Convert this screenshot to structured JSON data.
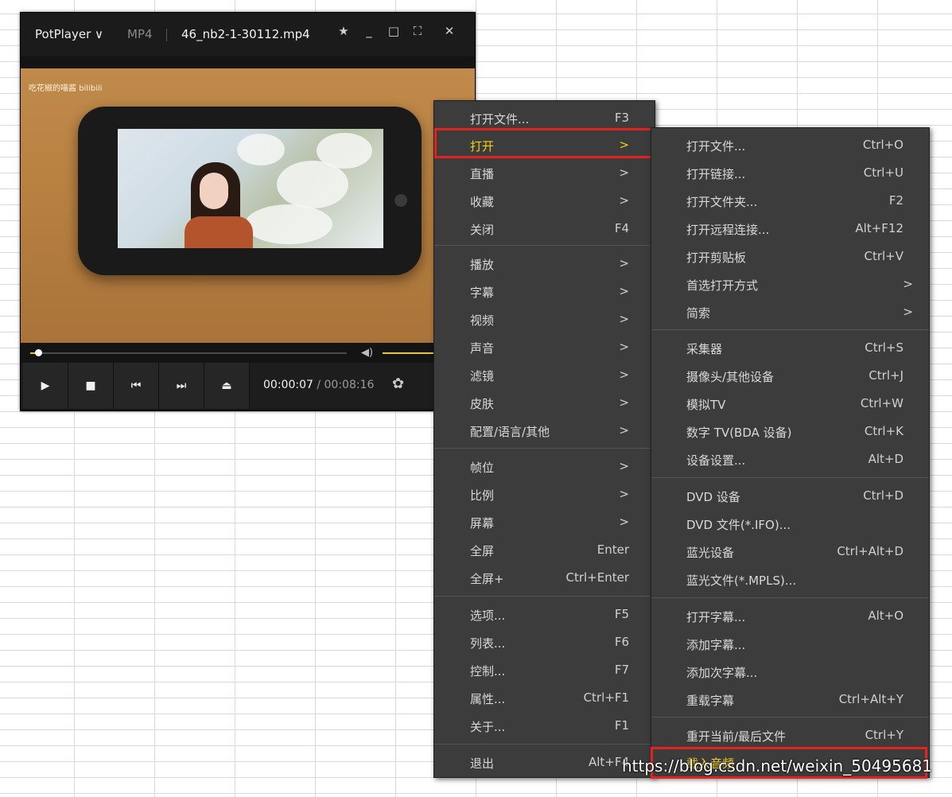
{
  "player": {
    "app_name": "PotPlayer ∨",
    "format": "MP4",
    "filename": "46_nb2-1-30112.mp4",
    "title_buttons": [
      "pin-icon",
      "minimize-icon",
      "maximize-icon",
      "fullscreen-icon",
      "close-icon"
    ],
    "time_current": "00:00:07",
    "time_separator": " / ",
    "time_total": "00:08:16",
    "watermark": "吃花椒的喵酱 bilibili",
    "progress_fraction": 0.02,
    "accent_color": "#f0c419"
  },
  "main_menu": {
    "items": [
      {
        "label": "打开文件...",
        "key": "F3"
      },
      {
        "label": "打开",
        "key": ">",
        "highlighted": true
      },
      {
        "label": "直播",
        "key": ">"
      },
      {
        "label": "收藏",
        "key": ">"
      },
      {
        "label": "关闭",
        "key": "F4"
      },
      {
        "label": "播放",
        "key": ">"
      },
      {
        "label": "字幕",
        "key": ">"
      },
      {
        "label": "视频",
        "key": ">"
      },
      {
        "label": "声音",
        "key": ">"
      },
      {
        "label": "滤镜",
        "key": ">"
      },
      {
        "label": "皮肤",
        "key": ">"
      },
      {
        "label": "配置/语言/其他",
        "key": ">"
      },
      {
        "label": "帧位",
        "key": ">"
      },
      {
        "label": "比例",
        "key": ">"
      },
      {
        "label": "屏幕",
        "key": ">"
      },
      {
        "label": "全屏",
        "key": "Enter"
      },
      {
        "label": "全屏+",
        "key": "Ctrl+Enter"
      },
      {
        "label": "选项...",
        "key": "F5"
      },
      {
        "label": "列表...",
        "key": "F6"
      },
      {
        "label": "控制...",
        "key": "F7"
      },
      {
        "label": "属性...",
        "key": "Ctrl+F1"
      },
      {
        "label": "关于...",
        "key": "F1"
      },
      {
        "label": "退出",
        "key": "Alt+F4"
      }
    ]
  },
  "open_submenu": {
    "items": [
      {
        "label": "打开文件...",
        "key": "Ctrl+O"
      },
      {
        "label": "打开链接...",
        "key": "Ctrl+U"
      },
      {
        "label": "打开文件夹...",
        "key": "F2"
      },
      {
        "label": "打开远程连接...",
        "key": "Alt+F12"
      },
      {
        "label": "打开剪贴板",
        "key": "Ctrl+V"
      },
      {
        "label": "首选打开方式",
        "key": ">"
      },
      {
        "label": "简索",
        "key": ">"
      },
      {
        "label": "采集器",
        "key": "Ctrl+S"
      },
      {
        "label": "摄像头/其他设备",
        "key": "Ctrl+J"
      },
      {
        "label": "模拟TV",
        "key": "Ctrl+W"
      },
      {
        "label": "数字 TV(BDA 设备)",
        "key": "Ctrl+K"
      },
      {
        "label": "设备设置...",
        "key": "Alt+D"
      },
      {
        "label": "DVD 设备",
        "key": "Ctrl+D"
      },
      {
        "label": "DVD 文件(*.IFO)...",
        "key": ""
      },
      {
        "label": "蓝光设备",
        "key": "Ctrl+Alt+D"
      },
      {
        "label": "蓝光文件(*.MPLS)...",
        "key": ""
      },
      {
        "label": "打开字幕...",
        "key": "Alt+O"
      },
      {
        "label": "添加字幕...",
        "key": ""
      },
      {
        "label": "添加次字幕...",
        "key": ""
      },
      {
        "label": "重载字幕",
        "key": "Ctrl+Alt+Y"
      },
      {
        "label": "重开当前/最后文件",
        "key": "Ctrl+Y"
      },
      {
        "label": "载入音频",
        "key": "",
        "highlighted": true
      }
    ]
  },
  "overlay_watermark": "https://blog.csdn.net/weixin_50495681"
}
